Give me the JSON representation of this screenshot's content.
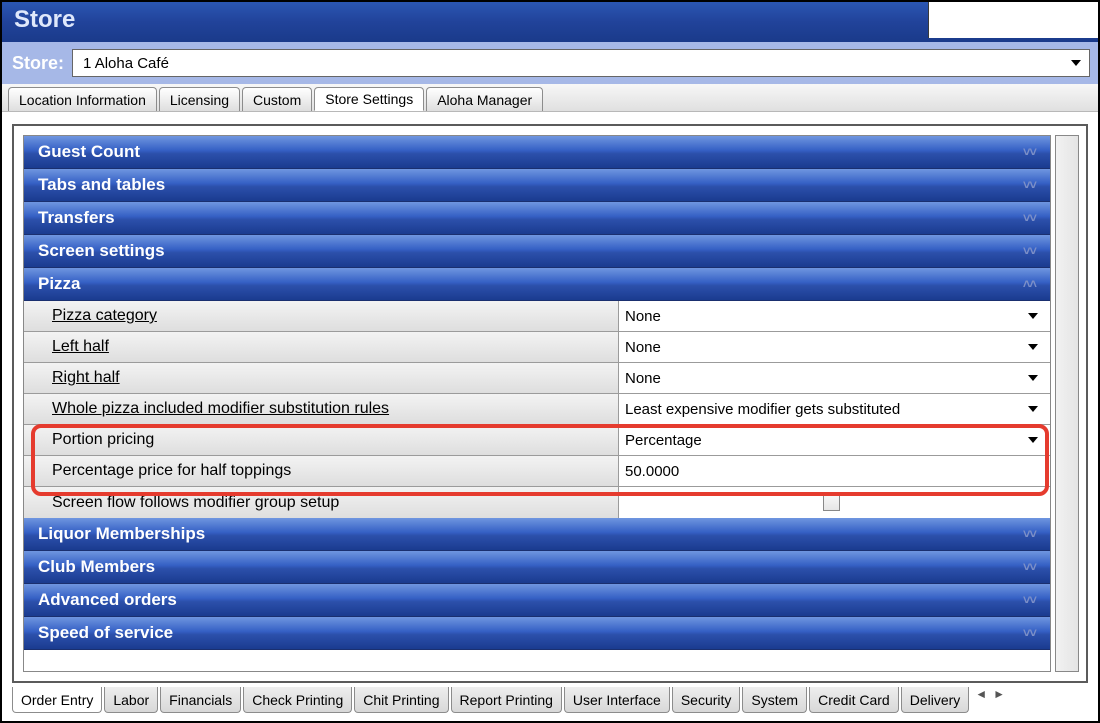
{
  "window": {
    "title": "Store"
  },
  "store_selector": {
    "label": "Store:",
    "value": "1 Aloha Café"
  },
  "top_tabs": {
    "items": [
      {
        "label": "Location Information",
        "active": false
      },
      {
        "label": "Licensing",
        "active": false
      },
      {
        "label": "Custom",
        "active": false
      },
      {
        "label": "Store Settings",
        "active": true
      },
      {
        "label": "Aloha Manager",
        "active": false
      }
    ]
  },
  "accordion": {
    "sections": [
      {
        "title": "Guest Count",
        "expanded": false
      },
      {
        "title": "Tabs and tables",
        "expanded": false
      },
      {
        "title": "Transfers",
        "expanded": false
      },
      {
        "title": "Screen settings",
        "expanded": false
      },
      {
        "title": "Pizza",
        "expanded": true
      },
      {
        "title": "Liquor Memberships",
        "expanded": false
      },
      {
        "title": "Club Members",
        "expanded": false
      },
      {
        "title": "Advanced orders",
        "expanded": false
      },
      {
        "title": "Speed of service",
        "expanded": false
      }
    ]
  },
  "pizza_settings": {
    "rows": [
      {
        "label": "Pizza category",
        "underline": true,
        "value": "None",
        "type": "dropdown"
      },
      {
        "label": "Left half",
        "underline": true,
        "value": "None",
        "type": "dropdown"
      },
      {
        "label": "Right half",
        "underline": true,
        "value": "None",
        "type": "dropdown"
      },
      {
        "label": "Whole pizza included modifier substitution rules",
        "underline": true,
        "value": "Least expensive modifier gets substituted",
        "type": "dropdown"
      },
      {
        "label": "Portion pricing",
        "underline": false,
        "value": "Percentage",
        "type": "dropdown"
      },
      {
        "label": "Percentage price for half toppings",
        "underline": false,
        "value": "50.0000",
        "type": "text"
      },
      {
        "label": "Screen flow follows modifier group setup",
        "underline": false,
        "value": "",
        "type": "checkbox"
      }
    ]
  },
  "bottom_tabs": {
    "items": [
      {
        "label": "Order Entry",
        "active": true
      },
      {
        "label": "Labor",
        "active": false
      },
      {
        "label": "Financials",
        "active": false
      },
      {
        "label": "Check Printing",
        "active": false
      },
      {
        "label": "Chit Printing",
        "active": false
      },
      {
        "label": "Report Printing",
        "active": false
      },
      {
        "label": "User Interface",
        "active": false
      },
      {
        "label": "Security",
        "active": false
      },
      {
        "label": "System",
        "active": false
      },
      {
        "label": "Credit Card",
        "active": false
      },
      {
        "label": "Delivery",
        "active": false
      }
    ]
  },
  "chevron": {
    "down": "˅˅",
    "up": "˄˄"
  }
}
